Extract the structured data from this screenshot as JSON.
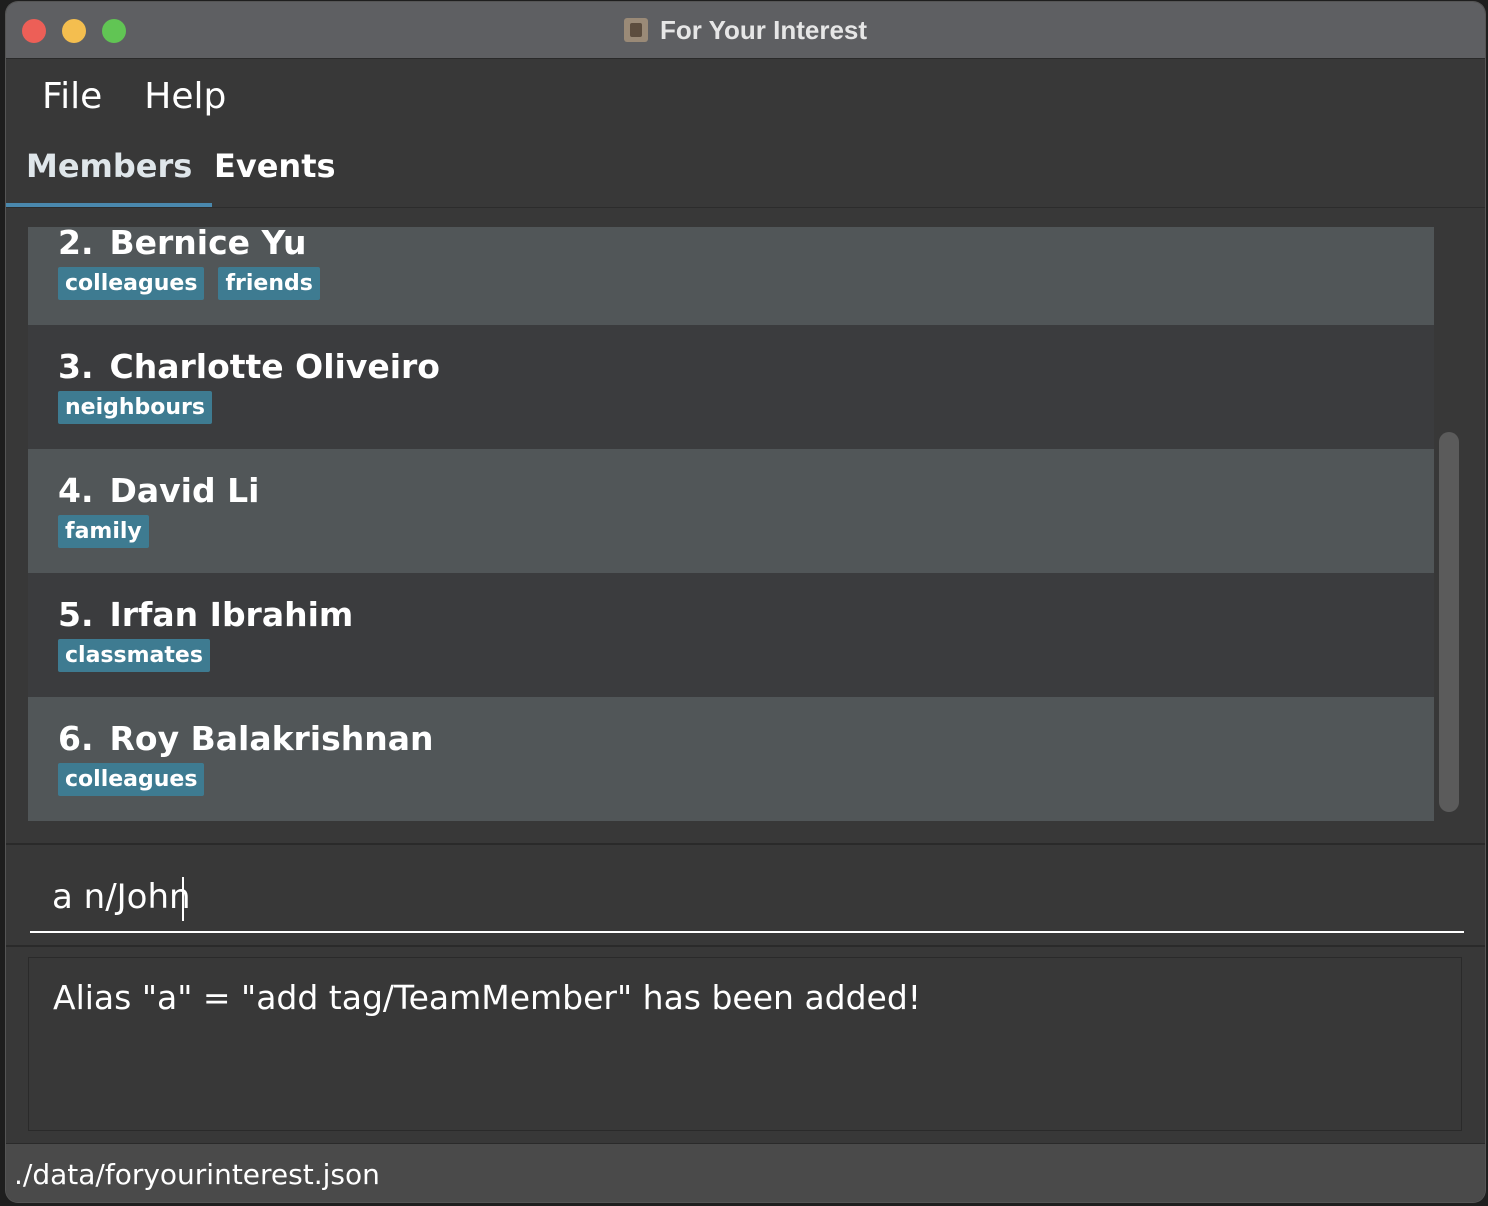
{
  "window": {
    "title": "For Your Interest"
  },
  "menu": {
    "file": "File",
    "help": "Help"
  },
  "tabs": {
    "members": "Members",
    "events": "Events"
  },
  "members": [
    {
      "index": "2.",
      "name": "Bernice Yu",
      "tags": [
        "colleagues",
        "friends"
      ]
    },
    {
      "index": "3.",
      "name": "Charlotte Oliveiro",
      "tags": [
        "neighbours"
      ]
    },
    {
      "index": "4.",
      "name": "David Li",
      "tags": [
        "family"
      ]
    },
    {
      "index": "5.",
      "name": "Irfan Ibrahim",
      "tags": [
        "classmates"
      ]
    },
    {
      "index": "6.",
      "name": "Roy Balakrishnan",
      "tags": [
        "colleagues"
      ]
    }
  ],
  "command": {
    "value": "a n/John"
  },
  "result": {
    "message": "Alias \"a\" = \"add tag/TeamMember\" has been added!"
  },
  "status": {
    "path": "./data/foryourinterest.json"
  },
  "colors": {
    "tag_bg": "#3e7b91",
    "tab_accent": "#4a88ad"
  }
}
